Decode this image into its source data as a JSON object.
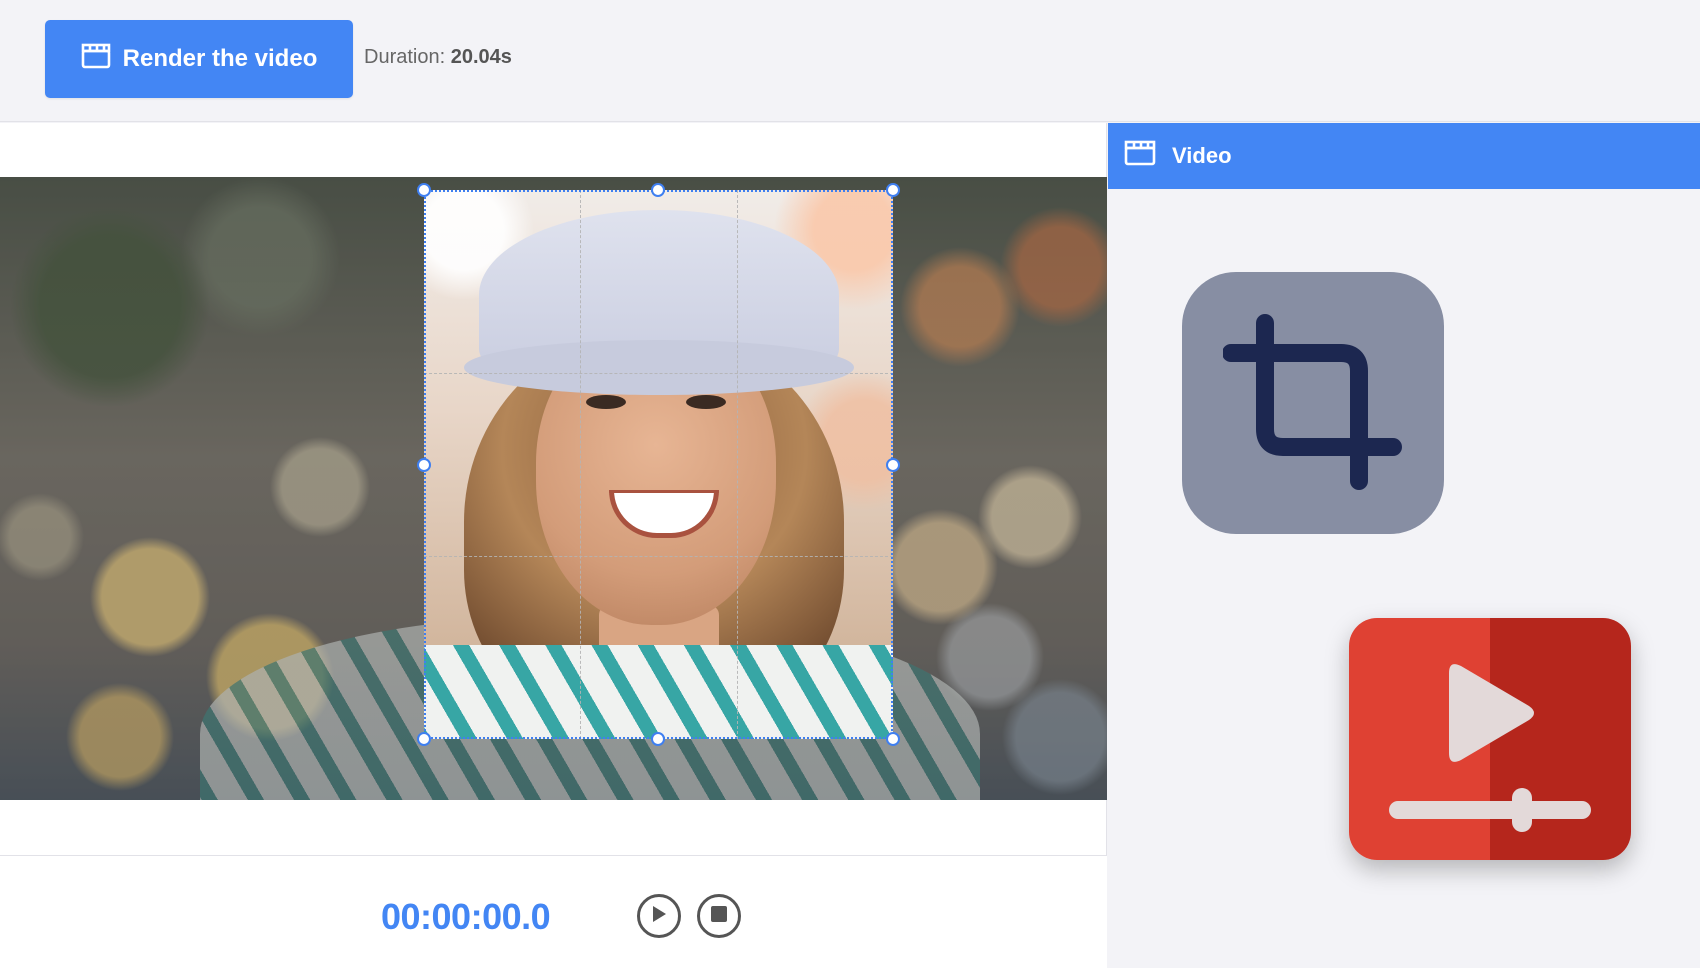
{
  "toolbar": {
    "render_label": "Render the video",
    "duration_label": "Duration:",
    "duration_value": "20.04s"
  },
  "player": {
    "timecode": "00:00:00.0",
    "play_icon": "play-icon",
    "stop_icon": "stop-icon"
  },
  "panel": {
    "title": "Video",
    "icons": [
      "clapperboard-icon",
      "crop-icon",
      "video-player-icon"
    ]
  },
  "colors": {
    "accent": "#4386f4",
    "crop_tile": "#878ea3",
    "crop_icon": "#1c2750",
    "video_tile_left": "#df4133",
    "video_tile_right": "#b5261c"
  }
}
